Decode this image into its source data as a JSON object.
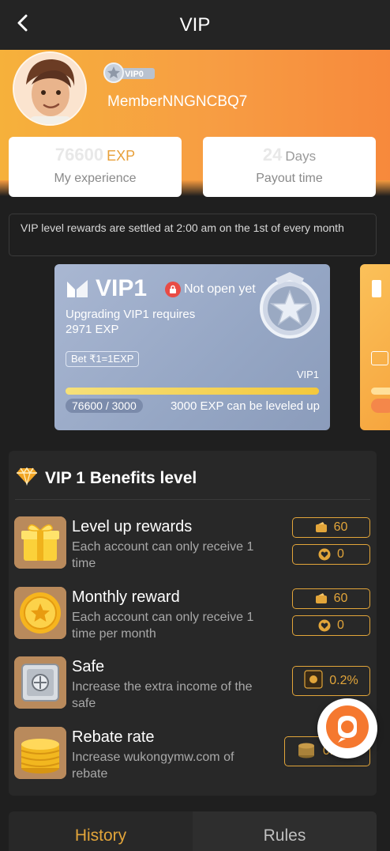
{
  "header": {
    "title": "VIP",
    "back_icon": "chevron-left-icon"
  },
  "profile": {
    "vip_badge": "VIP0",
    "member_name": "MemberNNGNCBQ7"
  },
  "stats": {
    "experience": {
      "value": "76600",
      "unit": "EXP",
      "label": "My experience"
    },
    "payout": {
      "value": "24",
      "unit": "Days",
      "label": "Payout time"
    }
  },
  "notice": "VIP level rewards are settled at 2:00 am on the 1st of every month",
  "vip_card": {
    "title": "VIP1",
    "lock_text": "Not open yet",
    "requirement_line1": "Upgrading VIP1 requires",
    "requirement_line2": "2971 EXP",
    "bet_rate": "Bet ₹1=1EXP",
    "level_label": "VIP1",
    "progress_text": "76600 / 3000",
    "progress_fraction": 1.0,
    "progress_note": "3000 EXP can be leveled up"
  },
  "benefits": {
    "title": "VIP 1 Benefits level",
    "items": [
      {
        "title": "Level up rewards",
        "desc": "Each account can only receive 1 time",
        "icon": "gift-icon",
        "pill1": "60",
        "pill2": "0"
      },
      {
        "title": "Monthly reward",
        "desc": "Each account can only receive 1 time per month",
        "icon": "coin-star-icon",
        "pill1": "60",
        "pill2": "0"
      },
      {
        "title": "Safe",
        "desc": "Increase the extra income of the safe",
        "icon": "safe-icon",
        "pill1": "0.2%"
      },
      {
        "title": "Rebate rate",
        "desc": "Increase wukongymw.com of rebate",
        "icon": "coin-stack-icon",
        "pill1": "0.05%"
      }
    ]
  },
  "tabs": {
    "history": "History",
    "rules": "Rules"
  },
  "colors": {
    "accent": "#e2a53a",
    "hero_start": "#f6b13b",
    "hero_end": "#f7893c",
    "card_blue": "#9aabc8"
  }
}
